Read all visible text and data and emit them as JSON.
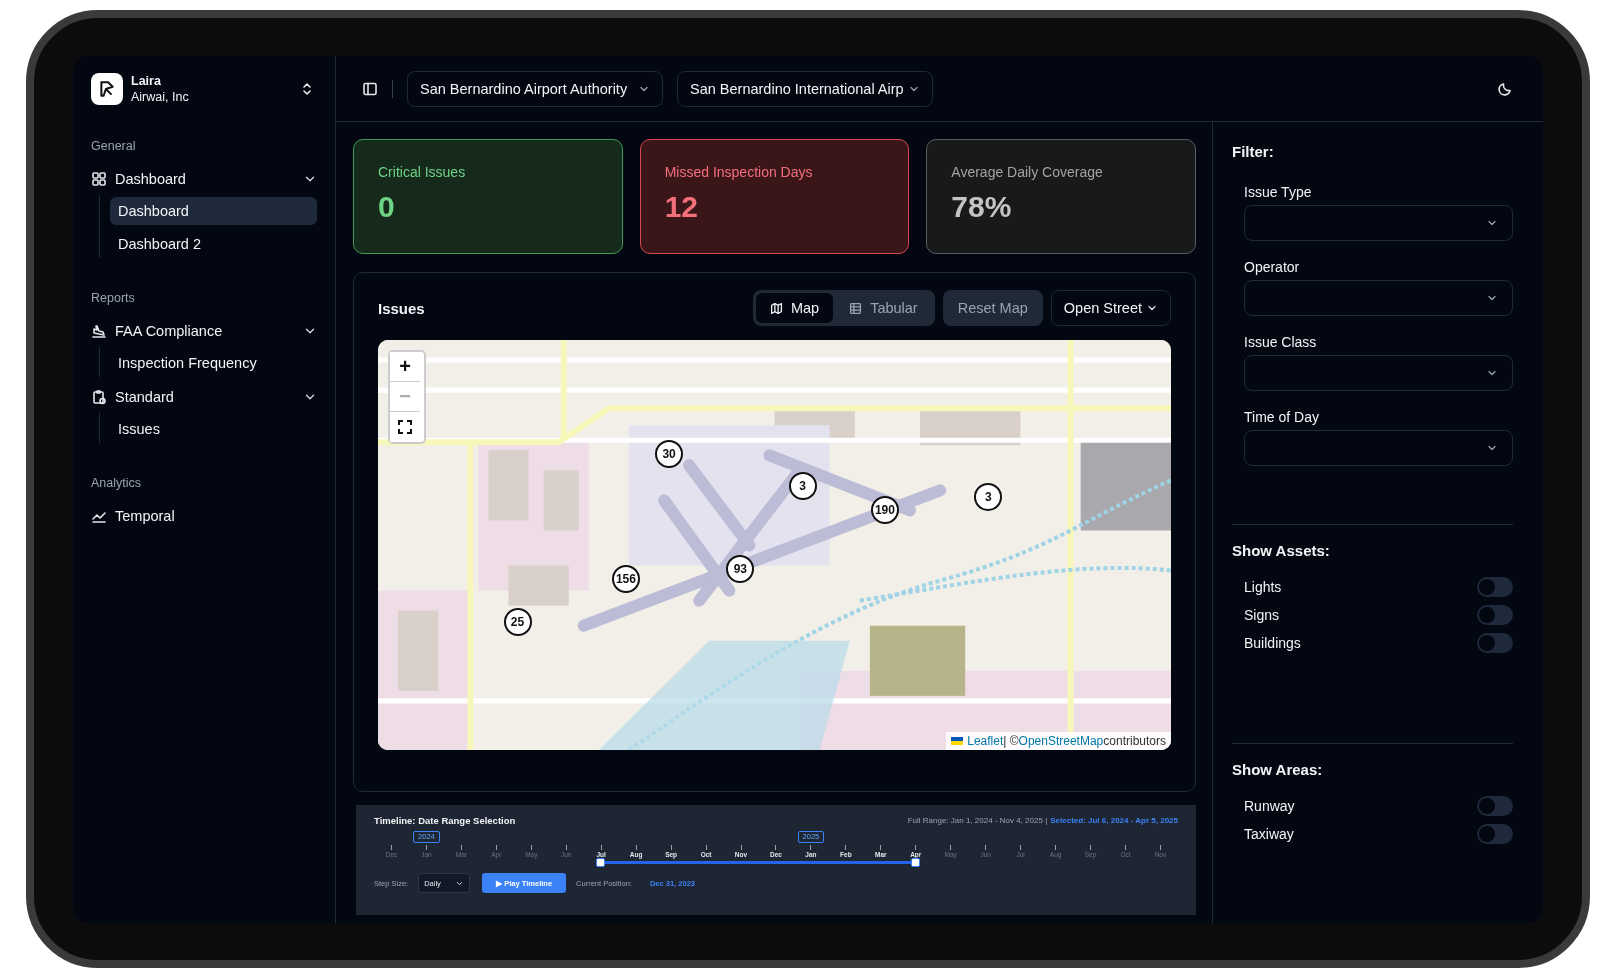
{
  "workspace": {
    "name": "Laira",
    "org": "Airwai, Inc"
  },
  "sidebar": {
    "groups": [
      {
        "label": "General",
        "items": [
          {
            "label": "Dashboard",
            "kind": "grid",
            "expanded": true,
            "children": [
              {
                "label": "Dashboard",
                "selected": true
              },
              {
                "label": "Dashboard 2",
                "selected": false
              }
            ]
          }
        ]
      },
      {
        "label": "Reports",
        "items": [
          {
            "label": "FAA Compliance",
            "kind": "plane",
            "expanded": true,
            "children": [
              {
                "label": "Inspection Frequency",
                "selected": false
              }
            ]
          },
          {
            "label": "Standard",
            "kind": "clipboard",
            "expanded": true,
            "children": [
              {
                "label": "Issues",
                "selected": false
              }
            ]
          }
        ]
      },
      {
        "label": "Analytics",
        "items": [
          {
            "label": "Temporal",
            "kind": "chart"
          }
        ]
      }
    ]
  },
  "topbar": {
    "selects": [
      {
        "value": "San Bernardino Airport Authority"
      },
      {
        "value": "San Bernardino International Airp"
      }
    ]
  },
  "stats": [
    {
      "label": "Critical Issues",
      "value": "0",
      "kind": "good"
    },
    {
      "label": "Missed Inspection Days",
      "value": "12",
      "kind": "bad"
    },
    {
      "label": "Average Daily Coverage",
      "value": "78%",
      "kind": "neutral"
    }
  ],
  "issues": {
    "title": "Issues",
    "views": [
      {
        "label": "Map",
        "kind": "map",
        "selected": true
      },
      {
        "label": "Tabular",
        "kind": "table",
        "selected": false
      }
    ],
    "reset": "Reset Map",
    "layer": "Open Street",
    "map": {
      "zoom_controls": [
        "+",
        "−"
      ],
      "clusters": [
        {
          "count": "30"
        },
        {
          "count": "3"
        },
        {
          "count": "190"
        },
        {
          "count": "3"
        },
        {
          "count": "156"
        },
        {
          "count": "93"
        },
        {
          "count": "25"
        }
      ],
      "attribution": {
        "link_1": "Leaflet",
        "separator": "| ©",
        "link_2": "OpenStreetMap",
        "suffix": "contributors"
      }
    }
  },
  "timeline": {
    "title": "Timeline: Date Range Selection",
    "full_range": "Full Range: Jan 1, 2024 - Nov 4, 2025 |",
    "selected_range": "Selected: Jul 6, 2024 - Apr 5, 2025",
    "months": [
      {
        "label": "Dec",
        "selected": false
      },
      {
        "label": "Jan",
        "year": "2024",
        "selected": false
      },
      {
        "label": "Mar",
        "selected": false
      },
      {
        "label": "Apr",
        "selected": false
      },
      {
        "label": "May",
        "selected": false
      },
      {
        "label": "Jun",
        "selected": false
      },
      {
        "label": "Jul",
        "selected": true
      },
      {
        "label": "Aug",
        "selected": true
      },
      {
        "label": "Sep",
        "selected": true
      },
      {
        "label": "Oct",
        "selected": true
      },
      {
        "label": "Nov",
        "selected": true
      },
      {
        "label": "Dec",
        "selected": true
      },
      {
        "label": "Jan",
        "year": "2025",
        "selected": true
      },
      {
        "label": "Feb",
        "selected": true
      },
      {
        "label": "Mar",
        "selected": true
      },
      {
        "label": "Apr",
        "selected": true
      },
      {
        "label": "May",
        "selected": false
      },
      {
        "label": "Jun",
        "selected": false
      },
      {
        "label": "Jul",
        "selected": false
      },
      {
        "label": "Aug",
        "selected": false
      },
      {
        "label": "Sep",
        "selected": false
      },
      {
        "label": "Oct",
        "selected": false
      },
      {
        "label": "Nov",
        "selected": false
      }
    ],
    "step_label": "Step Size:",
    "step_value": "Daily",
    "play": "▶ Play Timeline",
    "position_label": "Current Position:",
    "position_value": "Dec 31, 2023"
  },
  "filter": {
    "title": "Filter:",
    "fields": [
      {
        "label": "Issue Type"
      },
      {
        "label": "Operator"
      },
      {
        "label": "Issue Class"
      },
      {
        "label": "Time of Day"
      }
    ]
  },
  "assets": {
    "title": "Show Assets:",
    "toggles": [
      {
        "label": "Lights",
        "on": false
      },
      {
        "label": "Signs",
        "on": false
      },
      {
        "label": "Buildings",
        "on": false
      }
    ]
  },
  "areas": {
    "title": "Show Areas:",
    "toggles": [
      {
        "label": "Runway",
        "on": false
      },
      {
        "label": "Taxiway",
        "on": false
      }
    ]
  }
}
